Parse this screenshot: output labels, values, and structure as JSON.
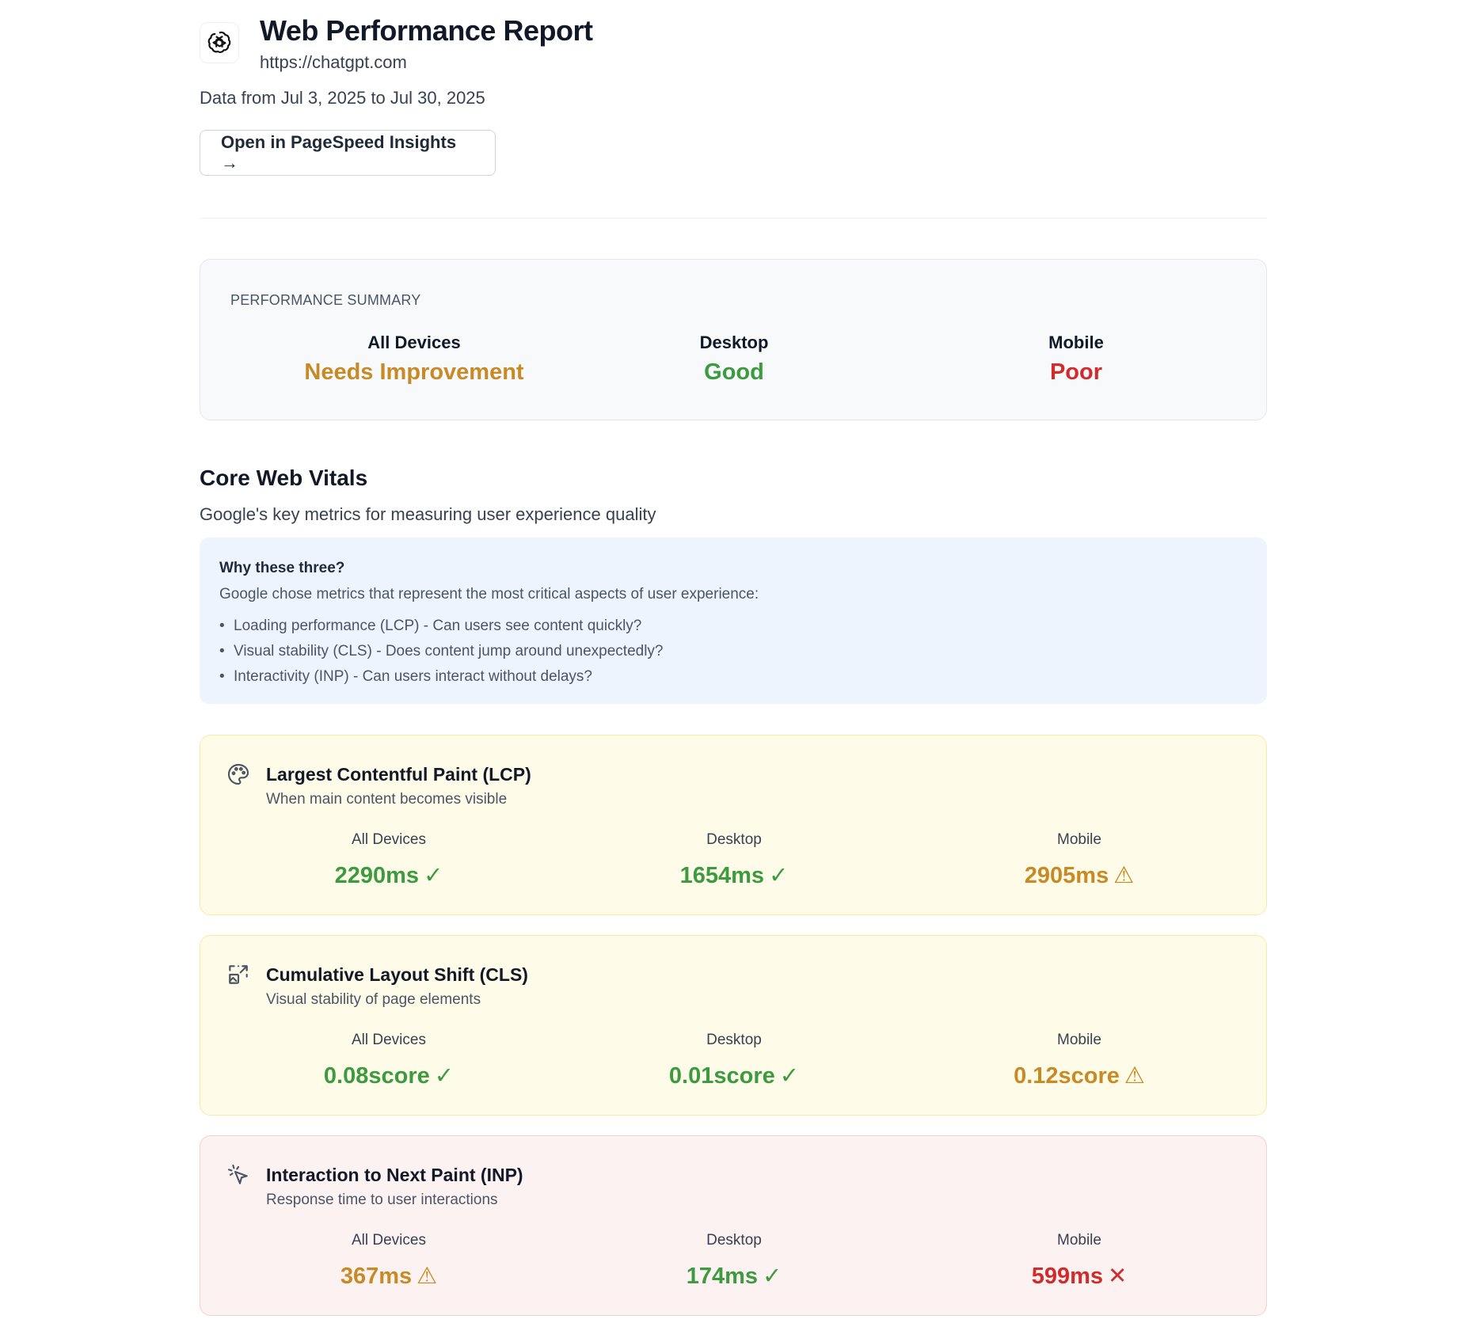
{
  "header": {
    "title": "Web Performance Report",
    "url": "https://chatgpt.com",
    "date_range": "Data from Jul 3, 2025 to Jul 30, 2025",
    "psi_button": "Open in PageSpeed Insights →",
    "logo_icon": "openai-logo-icon"
  },
  "summary": {
    "label": "PERFORMANCE SUMMARY",
    "columns": [
      {
        "device": "All Devices",
        "status": "Needs Improvement",
        "tone": "warn"
      },
      {
        "device": "Desktop",
        "status": "Good",
        "tone": "good"
      },
      {
        "device": "Mobile",
        "status": "Poor",
        "tone": "poor"
      }
    ]
  },
  "cwv": {
    "title": "Core Web Vitals",
    "subtitle": "Google's key metrics for measuring user experience quality",
    "why": {
      "title": "Why these three?",
      "description": "Google chose metrics that represent the most critical aspects of user experience:",
      "bullets": [
        "Loading performance (LCP) - Can users see content quickly?",
        "Visual stability (CLS) - Does content jump around unexpectedly?",
        "Interactivity (INP) - Can users interact without delays?"
      ]
    }
  },
  "metrics": [
    {
      "icon": "palette-icon",
      "title": "Largest Contentful Paint (LCP)",
      "description": "When main content becomes visible",
      "tone": "warn",
      "values": [
        {
          "device": "All Devices",
          "value": "2290ms",
          "symbol": "✓",
          "tone": "good"
        },
        {
          "device": "Desktop",
          "value": "1654ms",
          "symbol": "✓",
          "tone": "good"
        },
        {
          "device": "Mobile",
          "value": "2905ms",
          "symbol": "⚠",
          "tone": "warn"
        }
      ]
    },
    {
      "icon": "layout-shift-icon",
      "title": "Cumulative Layout Shift (CLS)",
      "description": "Visual stability of page elements",
      "tone": "warn",
      "values": [
        {
          "device": "All Devices",
          "value": "0.08score",
          "symbol": "✓",
          "tone": "good"
        },
        {
          "device": "Desktop",
          "value": "0.01score",
          "symbol": "✓",
          "tone": "good"
        },
        {
          "device": "Mobile",
          "value": "0.12score",
          "symbol": "⚠",
          "tone": "warn"
        }
      ]
    },
    {
      "icon": "pointer-click-icon",
      "title": "Interaction to Next Paint (INP)",
      "description": "Response time to user interactions",
      "tone": "poor",
      "values": [
        {
          "device": "All Devices",
          "value": "367ms",
          "symbol": "⚠",
          "tone": "warn"
        },
        {
          "device": "Desktop",
          "value": "174ms",
          "symbol": "✓",
          "tone": "good"
        },
        {
          "device": "Mobile",
          "value": "599ms",
          "symbol": "✕",
          "tone": "poor"
        }
      ]
    }
  ],
  "colors": {
    "good": "#3c9a3f",
    "warn": "#c88a25",
    "poor": "#d12c2c"
  }
}
